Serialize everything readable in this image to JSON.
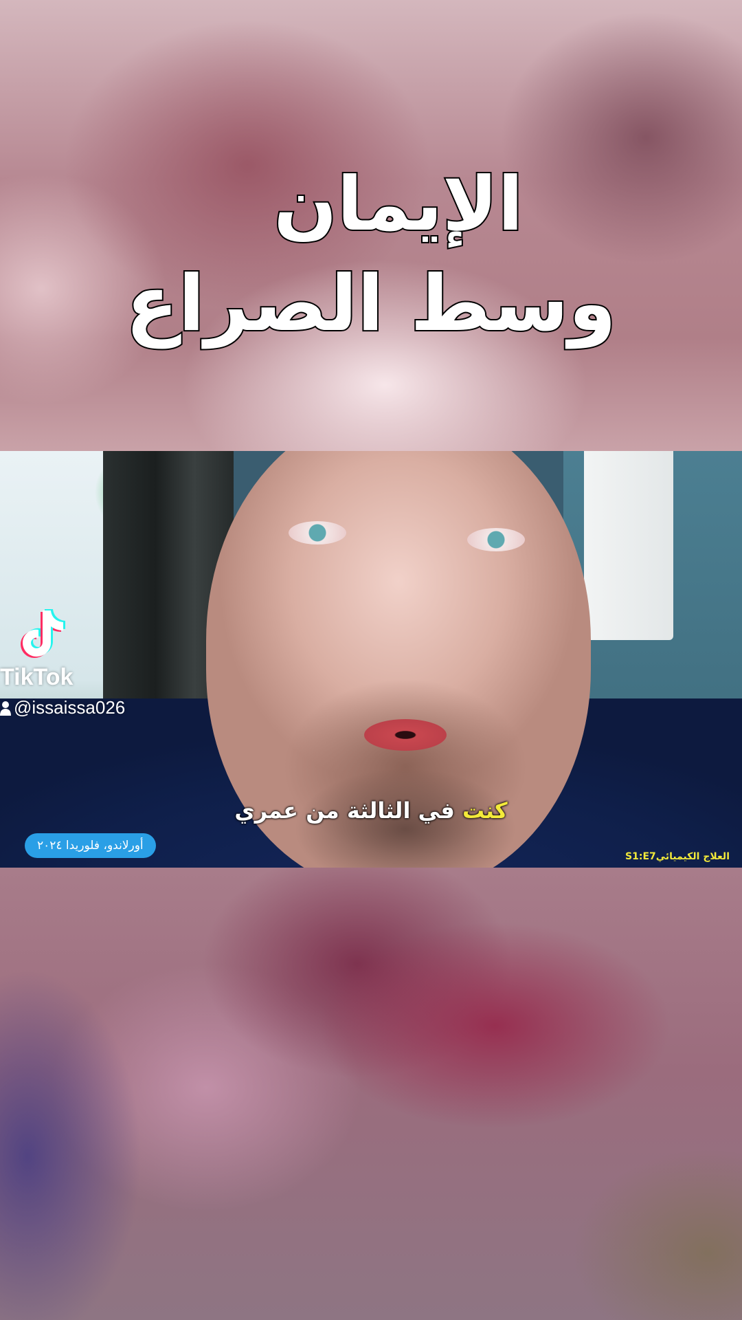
{
  "title": {
    "line1": "الإيمان",
    "line2": "وسط الصراع"
  },
  "watermark": {
    "brand": "TikTok",
    "handle": "@issaissa026",
    "icon": "tiktok-logo-icon"
  },
  "subtitle": {
    "highlight": "كنت",
    "rest": " في الثالثة من عمري"
  },
  "location_badge": "أورلاندو، فلوريدا ٢٠٢٤",
  "episode_label": "العلاج الكيميائيS1:E7",
  "colors": {
    "subtitle_highlight": "#f3ea3a",
    "badge_bg": "#2a9fe6",
    "episode_text": "#f3ea3a"
  }
}
